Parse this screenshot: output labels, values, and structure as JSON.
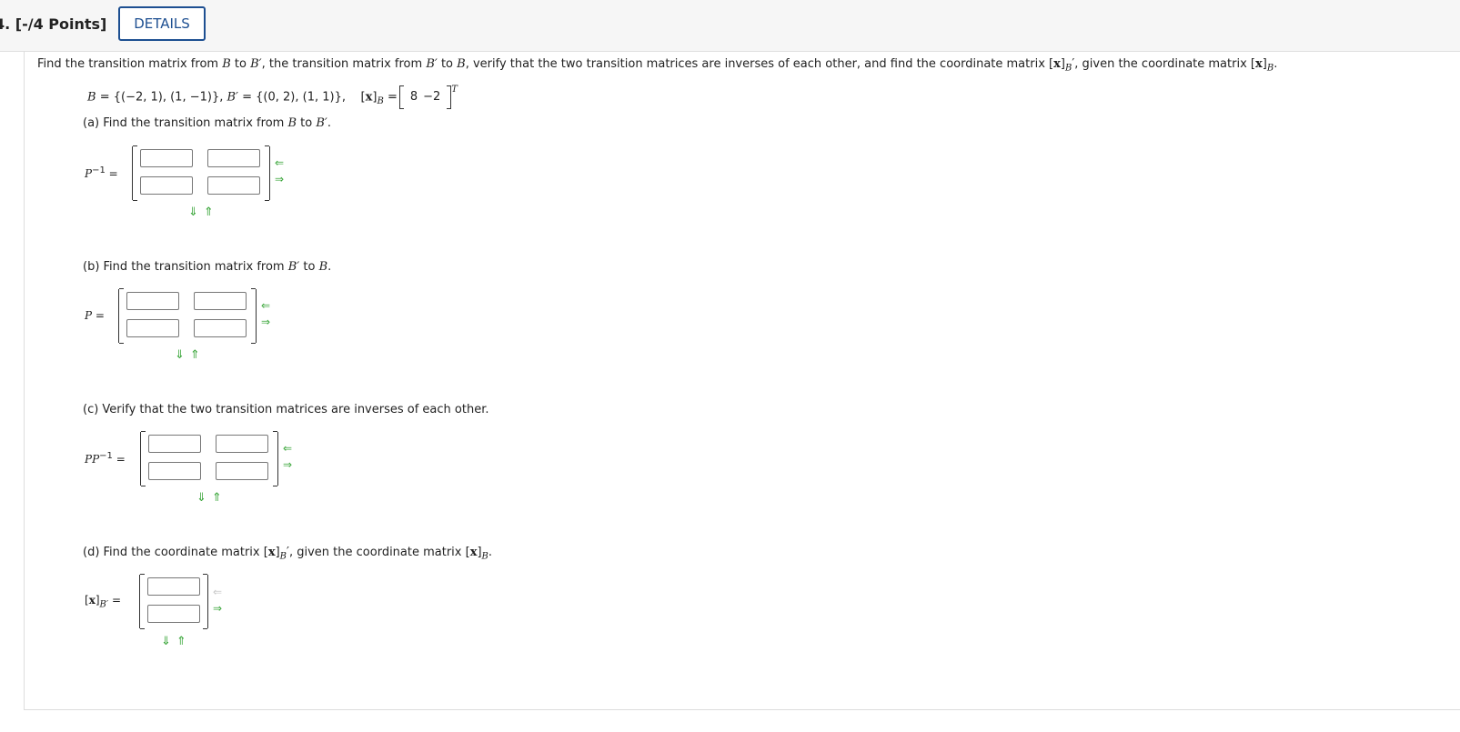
{
  "header": {
    "question": "4. [-/4 Points]",
    "details_label": "DETAILS"
  },
  "problem": {
    "prompt_a": "Find the transition matrix from ",
    "prompt_b": " to ",
    "prompt_c": ",  the transition matrix from ",
    "prompt_d": " to ",
    "prompt_e": ", verify that the two transition matrices are inverses of each other, and find the coordinate matrix ",
    "prompt_f": ",  given the coordinate matrix ",
    "B": "B",
    "Bp": "B′",
    "x": "x",
    "B_def": " = {(−2, 1), (1, −1)}, ",
    "Bp_def": " = {(0, 2), (1, 1)},",
    "xB_vals": [
      "8",
      "−2"
    ],
    "T": "T"
  },
  "parts": {
    "a": {
      "label": "(a) Find the transition matrix from ",
      "label_mid": " to ",
      "matrix_label": "P",
      "sup": "−1",
      "eq": " ="
    },
    "b": {
      "label": "(b) Find the transition matrix from ",
      "label_mid": " to ",
      "matrix_label": "P",
      "eq": " ="
    },
    "c": {
      "label": "(c) Verify that the two transition matrices are inverses of each other.",
      "matrix_label": "PP",
      "sup": "−1",
      "eq": " ="
    },
    "d": {
      "label": "(d) Find the coordinate matrix ",
      "label_mid": ",  given the coordinate matrix ",
      "eq": " ="
    }
  },
  "icons": {
    "left": "⇐",
    "right": "⇒",
    "down": "⇓",
    "up": "⇑"
  }
}
